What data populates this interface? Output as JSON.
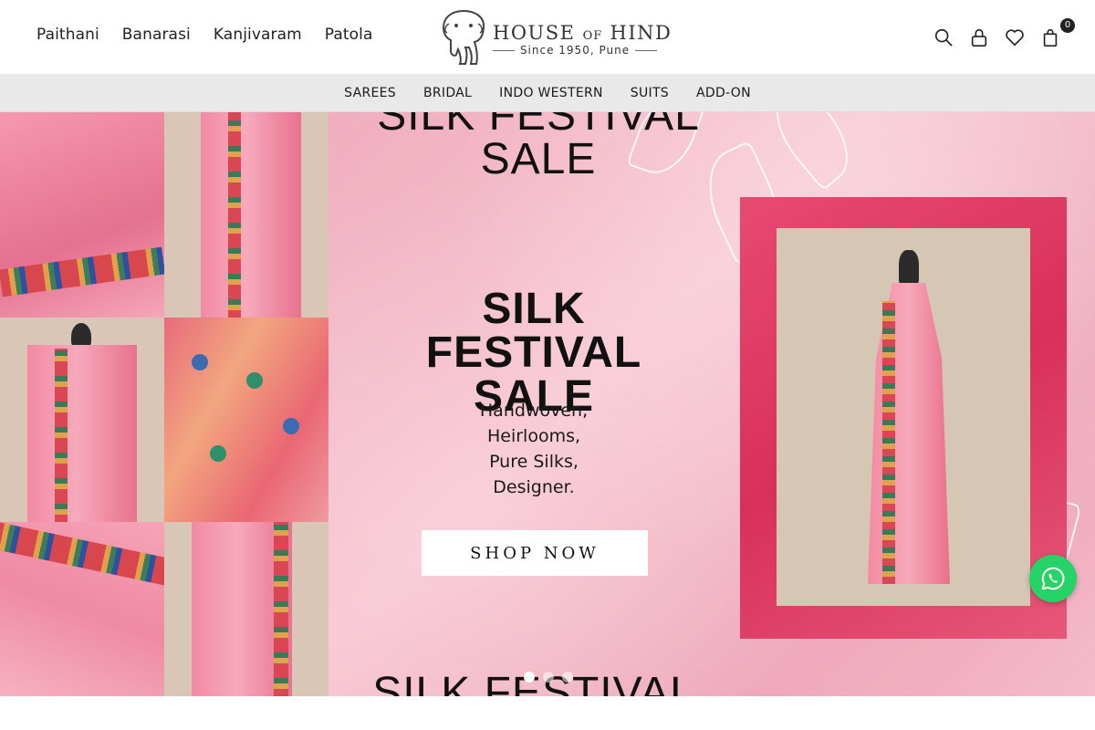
{
  "header": {
    "primary_nav": [
      "Paithani",
      "Banarasi",
      "Kanjivaram",
      "Patola"
    ],
    "logo": {
      "brand_main": "HOUSE",
      "brand_of": "OF",
      "brand_end": "HIND",
      "tagline": "Since 1950, Pune"
    },
    "icons": [
      "search-icon",
      "account-icon",
      "wishlist-icon",
      "cart-icon"
    ],
    "cart_count": "0"
  },
  "category_nav": [
    "SAREES",
    "BRIDAL",
    "INDO WESTERN",
    "SUITS",
    "ADD-ON"
  ],
  "hero": {
    "headline_line1": "SILK FESTIVAL",
    "headline_line2": "SALE",
    "lines": [
      "Handwoven,",
      "Heirlooms,",
      "Pure Silks,",
      "Designer."
    ],
    "cta": "SHOP NOW",
    "slides_count": 3,
    "active_slide": 1
  },
  "floating": {
    "whatsapp": "whatsapp-icon"
  },
  "colors": {
    "hero_pink": "#f3bccb",
    "category_bar": "#e9e9e9",
    "whatsapp_green": "#25d366",
    "text": "#1a1a1a"
  }
}
